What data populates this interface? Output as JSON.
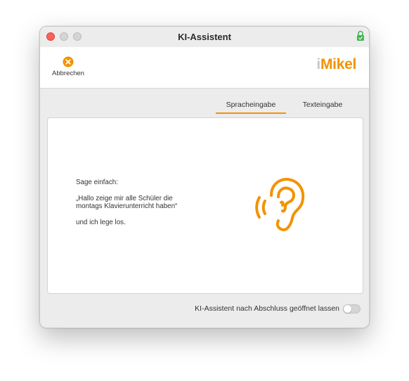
{
  "window": {
    "title": "KI-Assistent"
  },
  "toolbar": {
    "cancel_label": "Abbrechen",
    "logo_prefix": "i",
    "logo_text": "Mikel"
  },
  "tabs": [
    {
      "label": "Spracheingabe",
      "active": true
    },
    {
      "label": "Texteingabe",
      "active": false
    }
  ],
  "panel": {
    "line1": "Sage einfach:",
    "line2": "„Hallo zeige mir alle Schüler die montags Klavierunterricht haben“",
    "line3": "und ich lege los."
  },
  "footer": {
    "toggle_label": "KI-Assistent nach Abschluss geöffnet lassen",
    "toggle_on": false
  },
  "icons": {
    "cancel": "close-circle-icon",
    "listen": "ear-icon",
    "lock": "lock-icon"
  },
  "colors": {
    "accent": "#f39200",
    "close_dot": "#ff5f57",
    "lock": "#3fb950"
  }
}
